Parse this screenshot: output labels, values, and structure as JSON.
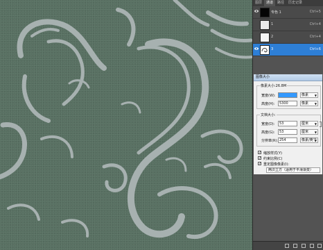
{
  "layers_panel": {
    "tabs": [
      "图层",
      "通道",
      "路径",
      "历史记录"
    ],
    "active_tab": 1,
    "layers": [
      {
        "name": "专色 1",
        "shortcut": "Ctrl+5",
        "thumb_color": "#050505",
        "selected": false
      },
      {
        "name": "1",
        "shortcut": "Ctrl+4",
        "thumb_color": "#e9e9e9",
        "selected": false
      },
      {
        "name": "2",
        "shortcut": "Ctrl+4",
        "thumb_color": "#f4f4f4",
        "selected": false
      },
      {
        "name": "3",
        "shortcut": "Ctrl+6",
        "thumb_color": "#ffffff",
        "selected": true
      }
    ]
  },
  "dialog": {
    "title": "图像大小",
    "pixel_dimensions": {
      "label": "像素大小:26.8M",
      "width_label": "宽度(W):",
      "width_value": "",
      "width_unit": "像素",
      "height_label": "高度(H):",
      "height_value": "5300",
      "height_unit": "像素"
    },
    "document_size": {
      "label": "文档大小:",
      "width_label": "宽度(D):",
      "width_value": "53",
      "width_unit": "厘米",
      "height_label": "高度(G):",
      "height_value": "53",
      "height_unit": "厘米",
      "resolution_label": "分辨率(R):",
      "resolution_value": "254",
      "resolution_unit": "像素/英寸"
    },
    "options": [
      {
        "label": "缩放样式(Y)",
        "checked": true
      },
      {
        "label": "约束比例(C)",
        "checked": true
      },
      {
        "label": "重定图像像素(I):",
        "checked": true
      }
    ],
    "resample_method": "两次立方（适用于平滑渐变）"
  },
  "colors": {
    "canvas_bg": "#587062",
    "pattern_stroke": "#a7b1b0",
    "selection_blue": "#2e7fd6"
  }
}
